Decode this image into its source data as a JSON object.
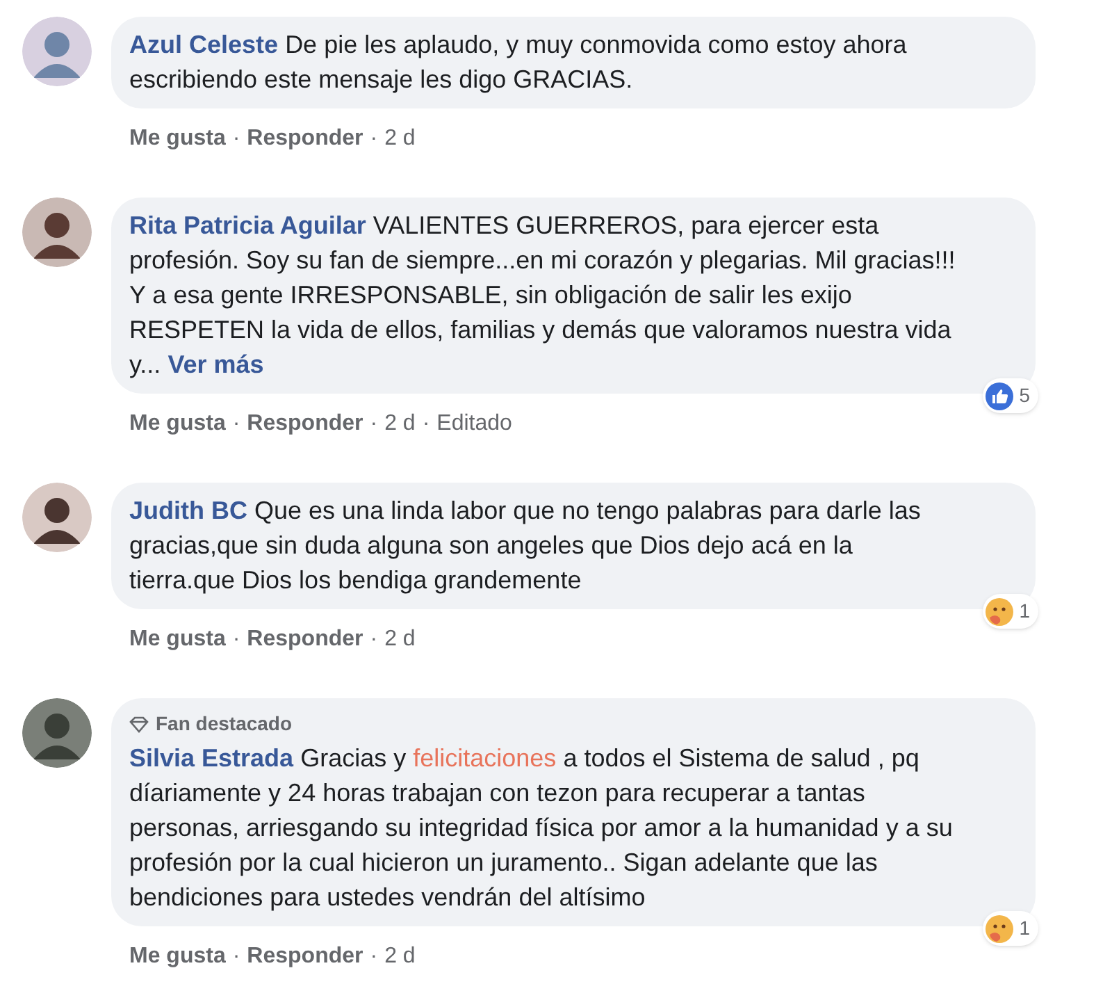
{
  "comments": [
    {
      "author": "Azul Celeste",
      "body": [
        {
          "kind": "plain",
          "text": "De pie les aplaudo, y muy conmovida como estoy ahora escribiendo este mensaje les digo GRACIAS."
        }
      ],
      "footer": [
        {
          "kind": "link",
          "text": "Me gusta"
        },
        {
          "kind": "sep",
          "text": "·"
        },
        {
          "kind": "link",
          "text": "Responder"
        },
        {
          "kind": "sep",
          "text": "·"
        },
        {
          "kind": "meta",
          "text": "2 d"
        }
      ]
    },
    {
      "author": "Rita Patricia Aguilar",
      "body": [
        {
          "kind": "plain",
          "text": "VALIENTES GUERREROS, para ejercer esta profesión. Soy su fan de siempre...en mi corazón y plegarias. Mil gracias!!! Y a esa gente IRRESPONSABLE, sin obligación de salir les exijo RESPETEN la vida de ellos, familias y demás que valoramos nuestra vida y..."
        }
      ],
      "more": "Ver más",
      "reaction": {
        "kind": "like",
        "count": "5"
      },
      "footer": [
        {
          "kind": "link",
          "text": "Me gusta"
        },
        {
          "kind": "sep",
          "text": "·"
        },
        {
          "kind": "link",
          "text": "Responder"
        },
        {
          "kind": "sep",
          "text": "·"
        },
        {
          "kind": "meta",
          "text": "2 d"
        },
        {
          "kind": "sep",
          "text": "·"
        },
        {
          "kind": "meta",
          "text": "Editado"
        }
      ]
    },
    {
      "author": "Judith BC",
      "body": [
        {
          "kind": "plain",
          "text": "Que es una linda labor que no tengo palabras para darle las gracias,que sin duda alguna son angeles que Dios dejo acá en la tierra.que Dios los bendiga grandemente"
        }
      ],
      "reaction": {
        "kind": "care",
        "count": "1"
      },
      "footer": [
        {
          "kind": "link",
          "text": "Me gusta"
        },
        {
          "kind": "sep",
          "text": "·"
        },
        {
          "kind": "link",
          "text": "Responder"
        },
        {
          "kind": "sep",
          "text": "·"
        },
        {
          "kind": "meta",
          "text": "2 d"
        }
      ]
    },
    {
      "author": "Silvia Estrada",
      "badge": "Fan destacado",
      "body": [
        {
          "kind": "plain",
          "text": "Gracias y "
        },
        {
          "kind": "highlight",
          "text": "felicitaciones"
        },
        {
          "kind": "plain",
          "text": " a todos el Sistema de salud , pq díariamente y 24 horas trabajan con tezon para recuperar a tantas personas, arriesgando su integridad física por amor a la humanidad y a su profesión por la cual hicieron un juramento.. Sigan adelante que las bendiciones para ustedes vendrán del altísimo"
        }
      ],
      "reaction": {
        "kind": "care",
        "count": "1"
      },
      "footer": [
        {
          "kind": "link",
          "text": "Me gusta"
        },
        {
          "kind": "sep",
          "text": "·"
        },
        {
          "kind": "link",
          "text": "Responder"
        },
        {
          "kind": "sep",
          "text": "·"
        },
        {
          "kind": "meta",
          "text": "2 d"
        }
      ]
    }
  ]
}
